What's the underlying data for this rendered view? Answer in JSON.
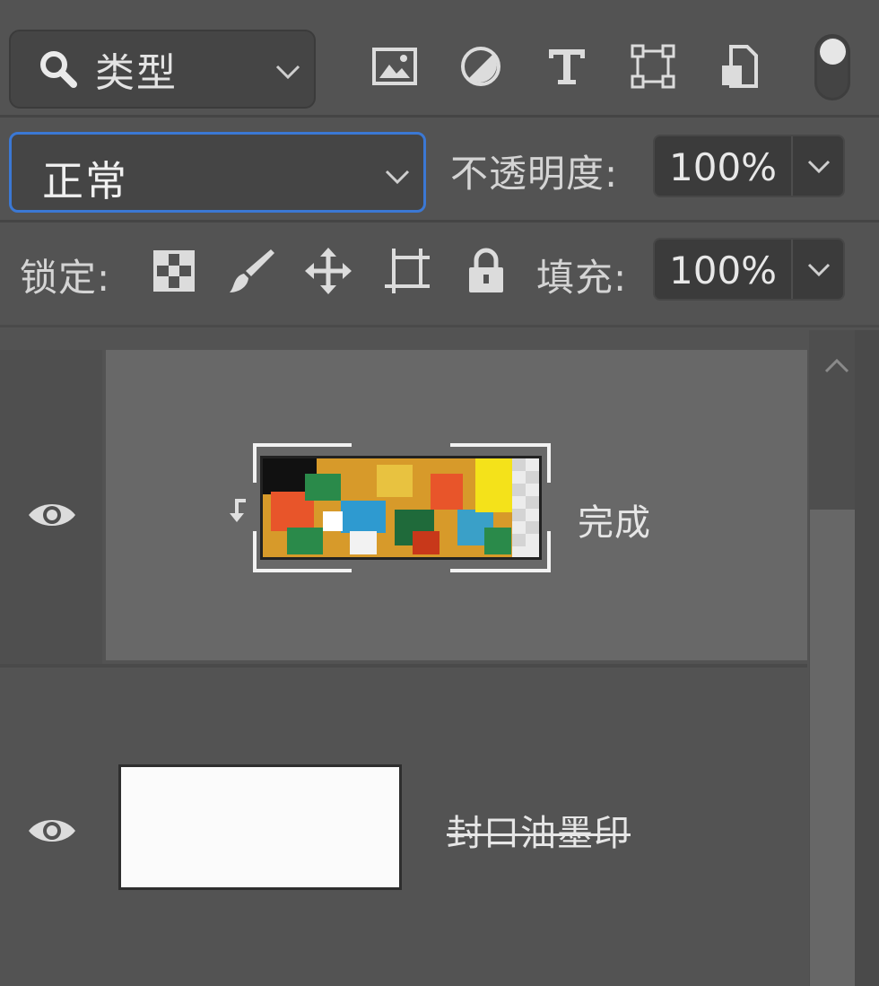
{
  "filter": {
    "kind_label": "类型",
    "icons": [
      "search-icon",
      "image-filter-icon",
      "adjustment-filter-icon",
      "type-filter-icon",
      "shape-filter-icon",
      "smart-object-filter-icon"
    ]
  },
  "blend": {
    "mode": "正常",
    "opacity_label": "不透明度:",
    "opacity_value": "100%"
  },
  "lock": {
    "label": "锁定:",
    "fill_label": "填充:",
    "fill_value": "100%",
    "icons": [
      "lock-transparent-icon",
      "lock-image-icon",
      "lock-position-icon",
      "lock-artboard-icon",
      "lock-all-icon"
    ]
  },
  "layers": [
    {
      "name": "完成",
      "selected": true,
      "clipped": true,
      "visible": true
    },
    {
      "name": "封口油墨印",
      "selected": false,
      "clipped": false,
      "visible": true
    }
  ],
  "colors": {
    "panel": "#535353",
    "selected_row": "#686868",
    "accent": "#3b78d4"
  }
}
